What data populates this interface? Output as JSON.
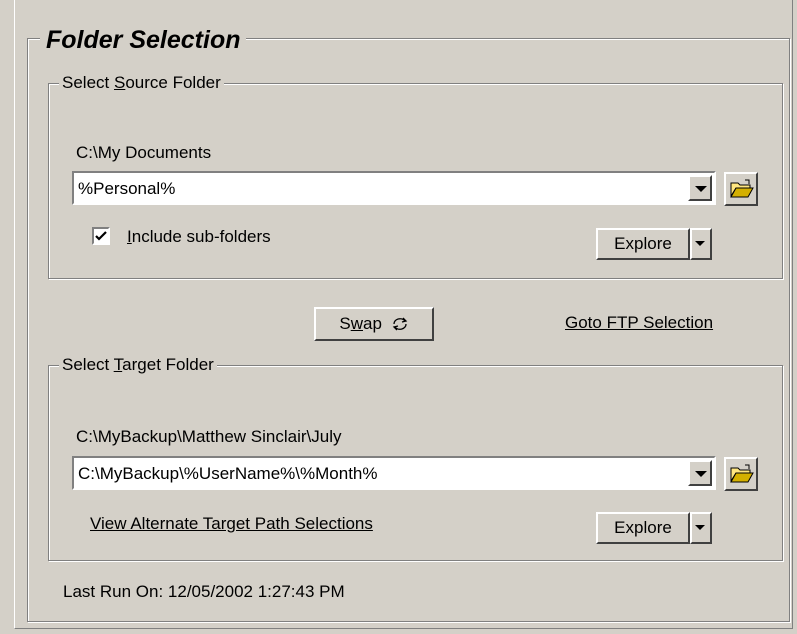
{
  "title": "Folder Selection",
  "source": {
    "group_title_pre": "Select ",
    "group_title_key": "S",
    "group_title_post": "ource Folder",
    "resolved_path": "C:\\My Documents",
    "combo_value": "%Personal%",
    "include_subfolders": {
      "label_key": "I",
      "label_rest": "nclude sub-folders",
      "checked": true
    },
    "explore_label": "Explore"
  },
  "swap": {
    "label_pre": "S",
    "label_key": "w",
    "label_post": "ap",
    "icon": "refresh-icon"
  },
  "goto_ftp_label": "Goto FTP Selection",
  "target": {
    "group_title_pre": "Select ",
    "group_title_key": "T",
    "group_title_post": "arget Folder",
    "resolved_path": "C:\\MyBackup\\Matthew Sinclair\\July",
    "combo_value": "C:\\MyBackup\\%UserName%\\%Month%",
    "alternate_link": "View Alternate Target Path Selections",
    "explore_label": "Explore"
  },
  "last_run": {
    "label": "Last Run On:",
    "value": "12/05/2002 1:27:43 PM"
  }
}
